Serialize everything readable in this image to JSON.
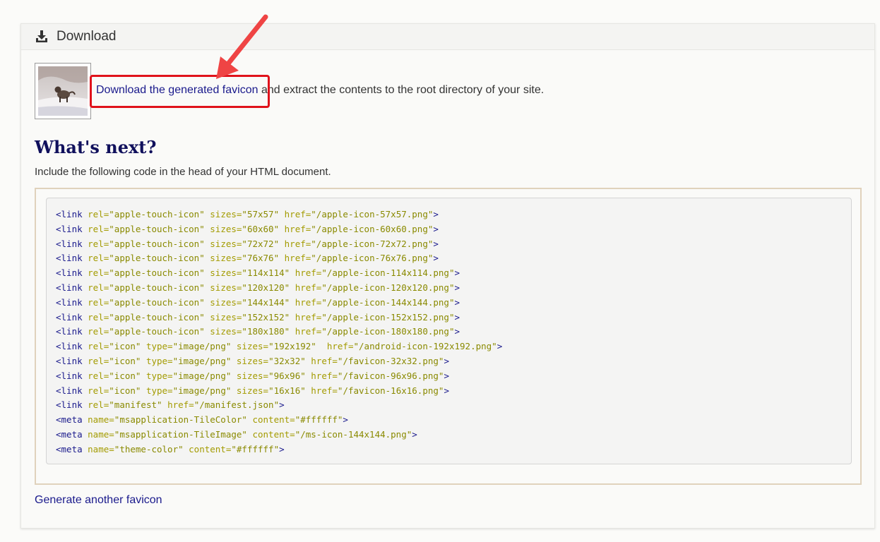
{
  "panel": {
    "title": "Download",
    "icon": "download-icon"
  },
  "intro": {
    "link_text": "Download the generated favicon",
    "rest_text": " and extract the contents to the root directory of your site."
  },
  "next": {
    "heading": "What's next?",
    "instruction": "Include the following code in the head of your HTML document."
  },
  "code_lines": [
    [
      [
        "t",
        "<link "
      ],
      [
        "a",
        "rel="
      ],
      [
        "v",
        "\"apple-touch-icon\" "
      ],
      [
        "a",
        "sizes="
      ],
      [
        "v",
        "\"57x57\" "
      ],
      [
        "a",
        "href="
      ],
      [
        "v",
        "\"/apple-icon-57x57.png\""
      ],
      [
        "t",
        ">"
      ]
    ],
    [
      [
        "t",
        "<link "
      ],
      [
        "a",
        "rel="
      ],
      [
        "v",
        "\"apple-touch-icon\" "
      ],
      [
        "a",
        "sizes="
      ],
      [
        "v",
        "\"60x60\" "
      ],
      [
        "a",
        "href="
      ],
      [
        "v",
        "\"/apple-icon-60x60.png\""
      ],
      [
        "t",
        ">"
      ]
    ],
    [
      [
        "t",
        "<link "
      ],
      [
        "a",
        "rel="
      ],
      [
        "v",
        "\"apple-touch-icon\" "
      ],
      [
        "a",
        "sizes="
      ],
      [
        "v",
        "\"72x72\" "
      ],
      [
        "a",
        "href="
      ],
      [
        "v",
        "\"/apple-icon-72x72.png\""
      ],
      [
        "t",
        ">"
      ]
    ],
    [
      [
        "t",
        "<link "
      ],
      [
        "a",
        "rel="
      ],
      [
        "v",
        "\"apple-touch-icon\" "
      ],
      [
        "a",
        "sizes="
      ],
      [
        "v",
        "\"76x76\" "
      ],
      [
        "a",
        "href="
      ],
      [
        "v",
        "\"/apple-icon-76x76.png\""
      ],
      [
        "t",
        ">"
      ]
    ],
    [
      [
        "t",
        "<link "
      ],
      [
        "a",
        "rel="
      ],
      [
        "v",
        "\"apple-touch-icon\" "
      ],
      [
        "a",
        "sizes="
      ],
      [
        "v",
        "\"114x114\" "
      ],
      [
        "a",
        "href="
      ],
      [
        "v",
        "\"/apple-icon-114x114.png\""
      ],
      [
        "t",
        ">"
      ]
    ],
    [
      [
        "t",
        "<link "
      ],
      [
        "a",
        "rel="
      ],
      [
        "v",
        "\"apple-touch-icon\" "
      ],
      [
        "a",
        "sizes="
      ],
      [
        "v",
        "\"120x120\" "
      ],
      [
        "a",
        "href="
      ],
      [
        "v",
        "\"/apple-icon-120x120.png\""
      ],
      [
        "t",
        ">"
      ]
    ],
    [
      [
        "t",
        "<link "
      ],
      [
        "a",
        "rel="
      ],
      [
        "v",
        "\"apple-touch-icon\" "
      ],
      [
        "a",
        "sizes="
      ],
      [
        "v",
        "\"144x144\" "
      ],
      [
        "a",
        "href="
      ],
      [
        "v",
        "\"/apple-icon-144x144.png\""
      ],
      [
        "t",
        ">"
      ]
    ],
    [
      [
        "t",
        "<link "
      ],
      [
        "a",
        "rel="
      ],
      [
        "v",
        "\"apple-touch-icon\" "
      ],
      [
        "a",
        "sizes="
      ],
      [
        "v",
        "\"152x152\" "
      ],
      [
        "a",
        "href="
      ],
      [
        "v",
        "\"/apple-icon-152x152.png\""
      ],
      [
        "t",
        ">"
      ]
    ],
    [
      [
        "t",
        "<link "
      ],
      [
        "a",
        "rel="
      ],
      [
        "v",
        "\"apple-touch-icon\" "
      ],
      [
        "a",
        "sizes="
      ],
      [
        "v",
        "\"180x180\" "
      ],
      [
        "a",
        "href="
      ],
      [
        "v",
        "\"/apple-icon-180x180.png\""
      ],
      [
        "t",
        ">"
      ]
    ],
    [
      [
        "t",
        "<link "
      ],
      [
        "a",
        "rel="
      ],
      [
        "v",
        "\"icon\" "
      ],
      [
        "a",
        "type="
      ],
      [
        "v",
        "\"image/png\" "
      ],
      [
        "a",
        "sizes="
      ],
      [
        "v",
        "\"192x192\"  "
      ],
      [
        "a",
        "href="
      ],
      [
        "v",
        "\"/android-icon-192x192.png\""
      ],
      [
        "t",
        ">"
      ]
    ],
    [
      [
        "t",
        "<link "
      ],
      [
        "a",
        "rel="
      ],
      [
        "v",
        "\"icon\" "
      ],
      [
        "a",
        "type="
      ],
      [
        "v",
        "\"image/png\" "
      ],
      [
        "a",
        "sizes="
      ],
      [
        "v",
        "\"32x32\" "
      ],
      [
        "a",
        "href="
      ],
      [
        "v",
        "\"/favicon-32x32.png\""
      ],
      [
        "t",
        ">"
      ]
    ],
    [
      [
        "t",
        "<link "
      ],
      [
        "a",
        "rel="
      ],
      [
        "v",
        "\"icon\" "
      ],
      [
        "a",
        "type="
      ],
      [
        "v",
        "\"image/png\" "
      ],
      [
        "a",
        "sizes="
      ],
      [
        "v",
        "\"96x96\" "
      ],
      [
        "a",
        "href="
      ],
      [
        "v",
        "\"/favicon-96x96.png\""
      ],
      [
        "t",
        ">"
      ]
    ],
    [
      [
        "t",
        "<link "
      ],
      [
        "a",
        "rel="
      ],
      [
        "v",
        "\"icon\" "
      ],
      [
        "a",
        "type="
      ],
      [
        "v",
        "\"image/png\" "
      ],
      [
        "a",
        "sizes="
      ],
      [
        "v",
        "\"16x16\" "
      ],
      [
        "a",
        "href="
      ],
      [
        "v",
        "\"/favicon-16x16.png\""
      ],
      [
        "t",
        ">"
      ]
    ],
    [
      [
        "t",
        "<link "
      ],
      [
        "a",
        "rel="
      ],
      [
        "v",
        "\"manifest\" "
      ],
      [
        "a",
        "href="
      ],
      [
        "v",
        "\"/manifest.json\""
      ],
      [
        "t",
        ">"
      ]
    ],
    [
      [
        "t",
        "<meta "
      ],
      [
        "a",
        "name="
      ],
      [
        "v",
        "\"msapplication-TileColor\" "
      ],
      [
        "a",
        "content="
      ],
      [
        "v",
        "\"#ffffff\""
      ],
      [
        "t",
        ">"
      ]
    ],
    [
      [
        "t",
        "<meta "
      ],
      [
        "a",
        "name="
      ],
      [
        "v",
        "\"msapplication-TileImage\" "
      ],
      [
        "a",
        "content="
      ],
      [
        "v",
        "\"/ms-icon-144x144.png\""
      ],
      [
        "t",
        ">"
      ]
    ],
    [
      [
        "t",
        "<meta "
      ],
      [
        "a",
        "name="
      ],
      [
        "v",
        "\"theme-color\" "
      ],
      [
        "a",
        "content="
      ],
      [
        "v",
        "\"#ffffff\""
      ],
      [
        "t",
        ">"
      ]
    ]
  ],
  "footer": {
    "link_text": "Generate another favicon"
  },
  "colors": {
    "link": "#1a1a8c",
    "heading": "#10105c",
    "highlight": "#e0121b",
    "arrow": "#ef4444"
  }
}
